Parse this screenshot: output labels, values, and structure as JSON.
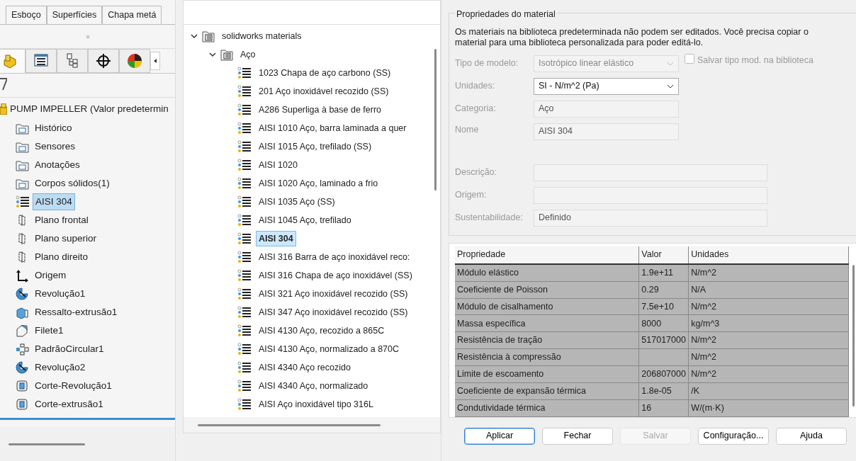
{
  "left_panel": {
    "tabs": [
      "Esboço",
      "Superfícies",
      "Chapa metá"
    ],
    "icon_tabs": [
      {
        "kind": "part",
        "selected": true
      },
      {
        "kind": "properties",
        "selected": false
      },
      {
        "kind": "config",
        "selected": false
      },
      {
        "kind": "target",
        "selected": false
      },
      {
        "kind": "appearance",
        "selected": false
      }
    ],
    "root": "PUMP IMPELLER (Valor predetermin",
    "items": [
      {
        "label": "Histórico",
        "kind": "folder",
        "selected": false
      },
      {
        "label": "Sensores",
        "kind": "folder",
        "selected": false
      },
      {
        "label": "Anotações",
        "kind": "folder",
        "selected": false
      },
      {
        "label": "Corpos sólidos(1)",
        "kind": "folder",
        "selected": false
      },
      {
        "label": "AISI 304",
        "kind": "material",
        "selected": true
      },
      {
        "label": "Plano frontal",
        "kind": "plane",
        "selected": false
      },
      {
        "label": "Plano superior",
        "kind": "plane",
        "selected": false
      },
      {
        "label": "Plano direito",
        "kind": "plane",
        "selected": false
      },
      {
        "label": "Origem",
        "kind": "origin",
        "selected": false
      },
      {
        "label": "Revolução1",
        "kind": "revolve",
        "selected": false
      },
      {
        "label": "Ressalto-extrusão1",
        "kind": "extrude",
        "selected": false
      },
      {
        "label": "Filete1",
        "kind": "fillet",
        "selected": false
      },
      {
        "label": "PadrãoCircular1",
        "kind": "pattern",
        "selected": false
      },
      {
        "label": "Revolução2",
        "kind": "revolve",
        "selected": false
      },
      {
        "label": "Corte-Revolução1",
        "kind": "cut",
        "selected": false
      },
      {
        "label": "Corte-extrusão1",
        "kind": "cut",
        "selected": false
      }
    ]
  },
  "material_tree": [
    {
      "label": "solidworks materials",
      "expanded": true,
      "children": [
        {
          "label": "Aço",
          "expanded": true,
          "children": [
            {
              "label": "1023 Chapa de aço carbono (SS)",
              "selected": false
            },
            {
              "label": "201 Aço inoxidável recozido (SS)",
              "selected": false
            },
            {
              "label": "A286 Superliga à base de ferro",
              "selected": false
            },
            {
              "label": "AISI 1010 Aço, barra laminada a quer",
              "selected": false
            },
            {
              "label": "AISI 1015 Aço, trefilado (SS)",
              "selected": false
            },
            {
              "label": "AISI 1020",
              "selected": false
            },
            {
              "label": "AISI 1020 Aço, laminado a frio",
              "selected": false
            },
            {
              "label": "AISI 1035 Aço (SS)",
              "selected": false
            },
            {
              "label": "AISI 1045 Aço, trefilado",
              "selected": false
            },
            {
              "label": "AISI 304",
              "selected": true
            },
            {
              "label": "AISI 316 Barra de aço inoxidável reco:",
              "selected": false
            },
            {
              "label": "AISI 316 Chapa de aço inoxidável (SS)",
              "selected": false
            },
            {
              "label": "AISI 321 Aço inoxidável recozido (SS)",
              "selected": false
            },
            {
              "label": "AISI 347 Aço inoxidável recozido (SS)",
              "selected": false
            },
            {
              "label": "AISI 4130 Aço, recozido a 865C",
              "selected": false
            },
            {
              "label": "AISI 4130 Aço, normalizado a 870C",
              "selected": false
            },
            {
              "label": "AISI 4340 Aço recozido",
              "selected": false
            },
            {
              "label": "AISI 4340 Aço, normalizado",
              "selected": false
            },
            {
              "label": "AISI Aço inoxidável tipo 316L",
              "selected": false
            }
          ]
        }
      ]
    }
  ],
  "properties": {
    "title": "Propriedades do material",
    "notice": "Os materiais na biblioteca predeterminada não podem ser editados. Você precisa copiar o material para uma biblioteca personalizada para poder editá-lo.",
    "fields": [
      {
        "label": "Tipo de modelo:",
        "value": "Isotrópico linear elástico",
        "kind": "select",
        "disabled": true
      },
      {
        "label": "Unidades:",
        "value": "SI - N/m^2 (Pa)",
        "kind": "select",
        "disabled": false
      },
      {
        "label": "Categoria:",
        "value": "Aço",
        "kind": "text",
        "disabled": true
      },
      {
        "label": "Nome",
        "value": "AISI 304",
        "kind": "text",
        "disabled": true
      },
      {
        "label": "Descrição:",
        "kind": "wide",
        "disabled": true
      },
      {
        "label": "Origem:",
        "kind": "wide",
        "disabled": true
      },
      {
        "label": "Sustentabilidade:",
        "value": "Definido",
        "kind": "wide",
        "disabled": true
      }
    ],
    "save_type": {
      "label": "Salvar tipo mod. na biblioteca",
      "checked": false
    }
  },
  "table": {
    "columns": [
      "Propriedade",
      "Valor",
      "Unidades"
    ],
    "rows": [
      [
        "Módulo elástico",
        "1.9e+11",
        "N/m^2"
      ],
      [
        "Coeficiente de Poisson",
        "0.29",
        "N/A"
      ],
      [
        "Módulo de cisalhamento",
        "7.5e+10",
        "N/m^2"
      ],
      [
        "Massa específica",
        "8000",
        "kg/m^3"
      ],
      [
        "Resistência de tração",
        "517017000",
        "N/m^2"
      ],
      [
        "Resistência à compressão",
        "",
        "N/m^2"
      ],
      [
        "Limite de escoamento",
        "206807000",
        "N/m^2"
      ],
      [
        "Coeficiente de expansão térmica",
        "1.8e-05",
        "/K"
      ],
      [
        "Condutividade térmica",
        "16",
        "W/(m·K)"
      ]
    ]
  },
  "buttons": [
    {
      "label": "Aplicar",
      "disabled": false,
      "focused": true
    },
    {
      "label": "Fechar",
      "disabled": false,
      "focused": false
    },
    {
      "label": "Salvar",
      "disabled": true,
      "focused": false
    },
    {
      "label": "Configuração...",
      "disabled": false,
      "focused": false
    },
    {
      "label": "Ajuda",
      "disabled": false,
      "focused": false
    }
  ]
}
